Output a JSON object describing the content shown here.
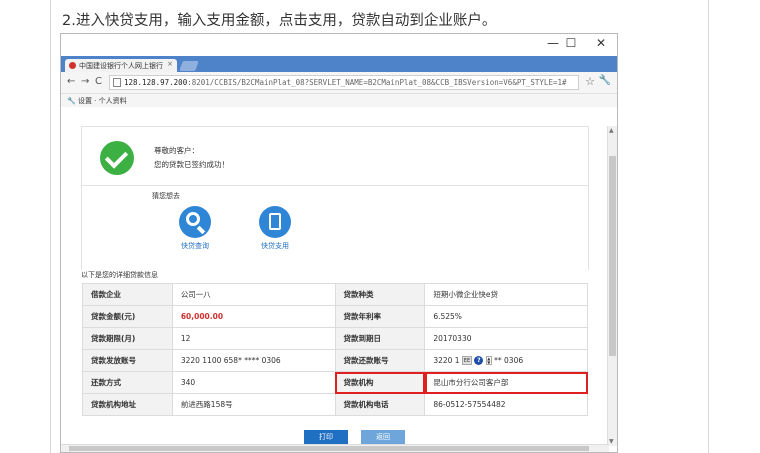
{
  "caption": "2.进入快贷支用，输入支用金额，点击支用，贷款自动到企业账户。",
  "window": {
    "minimize": "—",
    "maximize": "☐",
    "close": "✕"
  },
  "browser": {
    "tab_title": "中国建设银行个人网上银行",
    "tab_close": "×",
    "back": "←",
    "forward": "→",
    "reload": "C",
    "url_host": "128.128.97.200",
    "url_path": ":8201/CCBIS/B2CMainPlat_08?SERVLET_NAME=B2CMainPlat_08&CCB_IBSVersion=V6&PT_STYLE=1#",
    "bookmarks_bar": "设置 · 个人资料"
  },
  "success": {
    "greeting": "尊敬的客户：",
    "message": "您的贷款已签约成功！"
  },
  "guess": {
    "title": "猜您想去",
    "items": [
      {
        "label": "快贷查询",
        "icon": "magnifier-icon"
      },
      {
        "label": "快贷支用",
        "icon": "document-icon"
      }
    ]
  },
  "detail": {
    "title": "以下是您的详细贷款信息",
    "rows": [
      {
        "l1": "借款企业",
        "v1": "公司一八",
        "l2": "贷款种类",
        "v2": "短期小微企业快e贷"
      },
      {
        "l1": "贷款金额(元)",
        "v1": "60,000.00",
        "l2": "贷款年利率",
        "v2": "6.525%"
      },
      {
        "l1": "贷款期限(月)",
        "v1": "12",
        "l2": "贷款到期日",
        "v2": "20170330"
      },
      {
        "l1": "贷款发放账号",
        "v1": "3220 1100 658* **** 0306",
        "l2": "贷款还款账号",
        "v2a": "3220 1",
        "v2b": "** 0306"
      },
      {
        "l1": "还款方式",
        "v1": "340",
        "l2": "贷款机构",
        "v2": "昆山市分行公司客户部"
      },
      {
        "l1": "贷款机构地址",
        "v1": "前进西路158号",
        "l2": "贷款机构电话",
        "v2": "86-0512-57554482"
      }
    ],
    "mini_ctrl": "EE",
    "mini_q": "?"
  },
  "buttons": {
    "print": "打印",
    "back": "返回"
  },
  "colors": {
    "accent": "#1f6fc2",
    "success": "#3cb043",
    "highlight": "#e02020",
    "amount": "#d32f2f"
  }
}
